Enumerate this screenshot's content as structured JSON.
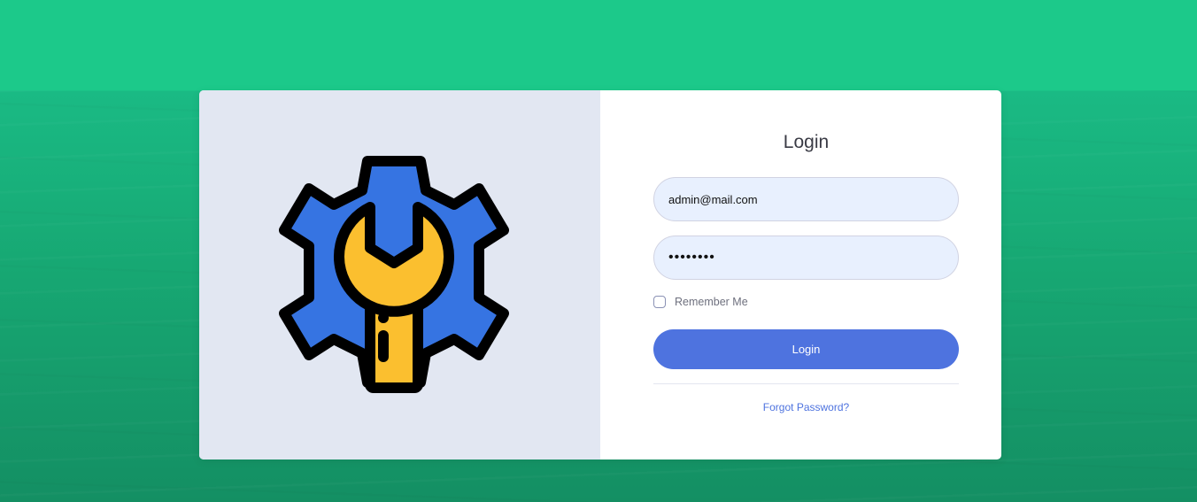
{
  "login": {
    "title": "Login",
    "email_value": "admin@mail.com",
    "password_value": "••••••••",
    "remember_label": "Remember Me",
    "remember_checked": false,
    "button_label": "Login",
    "forgot_label": "Forgot Password?"
  },
  "logo": {
    "icon": "gear-wrench-icon",
    "gear_color": "#3674e2",
    "wrench_color": "#fbbf2f",
    "outline_color": "#000000"
  },
  "colors": {
    "background": "#1cc88a",
    "primary": "#4e73df",
    "left_panel": "#e2e7f2"
  }
}
